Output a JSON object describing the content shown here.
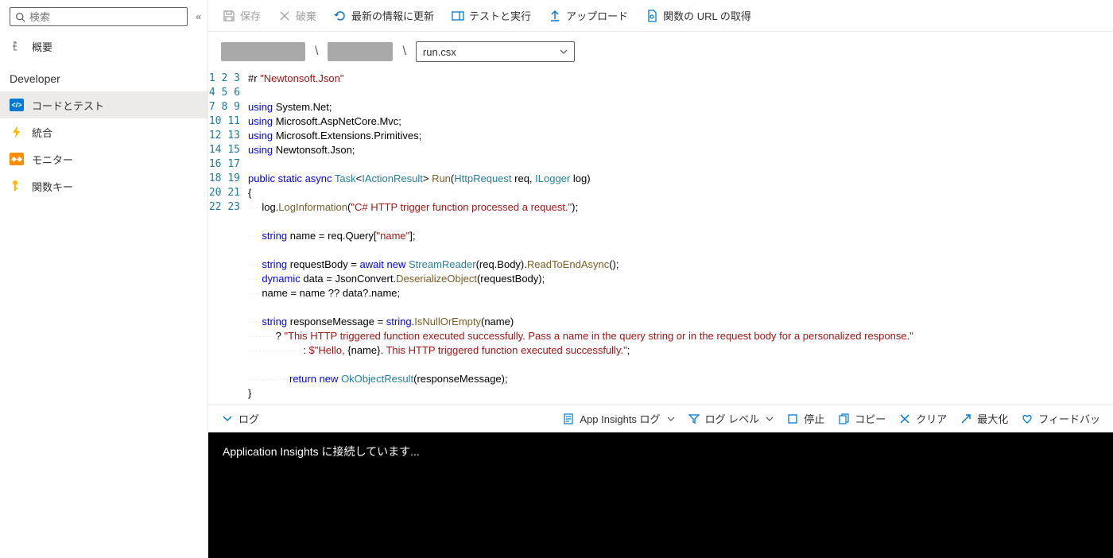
{
  "search": {
    "placeholder": "検索"
  },
  "sidebar": {
    "overview": {
      "label": "概要"
    },
    "sectionDeveloper": "Developer",
    "items": [
      {
        "label": "コードとテスト"
      },
      {
        "label": "統合"
      },
      {
        "label": "モニター"
      },
      {
        "label": "関数キー"
      }
    ]
  },
  "toolbar": {
    "save": "保存",
    "discard": "破棄",
    "refresh": "最新の情報に更新",
    "testRun": "テストと実行",
    "upload": "アップロード",
    "getFunctionUrl": "関数の URL の取得"
  },
  "breadcrumb": {
    "fileSelected": "run.csx"
  },
  "editor": {
    "lineCount": 23,
    "lines": [
      {
        "html": "#r <span class='str'>\"Newtonsoft.Json\"</span>"
      },
      {
        "html": ""
      },
      {
        "html": "<span class='kw'>using</span> System.Net;"
      },
      {
        "html": "<span class='kw'>using</span> Microsoft.AspNetCore.Mvc;"
      },
      {
        "html": "<span class='kw'>using</span> Microsoft.Extensions.Primitives;"
      },
      {
        "html": "<span class='kw'>using</span> Newtonsoft.Json;"
      },
      {
        "html": ""
      },
      {
        "html": "<span class='kw'>public</span> <span class='kw'>static</span> <span class='kw'>async</span> <span class='type'>Task</span>&lt;<span class='type'>IActionResult</span>&gt; <span class='fn'>Run</span>(<span class='type'>HttpRequest</span> req, <span class='type'>ILogger</span> log)"
      },
      {
        "html": "{"
      },
      {
        "html": "<span class='indent-guide'>····</span>log.<span class='mtd'>LogInformation</span>(<span class='str'>\"C# HTTP trigger function processed a request.\"</span>);"
      },
      {
        "html": ""
      },
      {
        "html": "<span class='indent-guide'>····</span><span class='kw'>string</span> name = req.Query[<span class='str'>\"name\"</span>];"
      },
      {
        "html": ""
      },
      {
        "html": "<span class='indent-guide'>····</span><span class='kw'>string</span> requestBody = <span class='kw'>await</span> <span class='kw'>new</span> <span class='type'>StreamReader</span>(req.Body).<span class='mtd'>ReadToEndAsync</span>();"
      },
      {
        "html": "<span class='indent-guide'>····</span><span class='kw'>dynamic</span> data = JsonConvert.<span class='mtd'>DeserializeObject</span>(requestBody);"
      },
      {
        "html": "<span class='indent-guide'>····</span>name = name ?? data?.name;"
      },
      {
        "html": ""
      },
      {
        "html": "<span class='indent-guide'>····</span><span class='kw'>string</span> responseMessage = <span class='kw'>string</span>.<span class='mtd'>IsNullOrEmpty</span>(name)"
      },
      {
        "html": "<span class='indent-guide'>····</span><span class='indent-guide'>····</span>? <span class='str'>\"This HTTP triggered function executed successfully. Pass a name in the query string or in the request body for a personalized response.\"</span>"
      },
      {
        "html": "<span class='indent-guide'>····</span><span class='indent-guide'>····</span><span class='indent-guide'>····</span><span class='indent-guide'>····</span>: <span class='str'>$\"Hello, </span>{name}<span class='str'>. This HTTP triggered function executed successfully.\"</span>;"
      },
      {
        "html": ""
      },
      {
        "html": "<span class='indent-guide'>····</span><span class='indent-guide'>····</span><span class='indent-guide'>····</span><span class='kw'>return</span> <span class='kw'>new</span> <span class='type'>OkObjectResult</span>(responseMessage);"
      },
      {
        "html": "}"
      }
    ]
  },
  "logBar": {
    "log": "ログ",
    "appInsights": "App Insights ログ",
    "logLevel": "ログ レベル",
    "stop": "停止",
    "copy": "コピー",
    "clear": "クリア",
    "maximize": "最大化",
    "feedback": "フィードバッ"
  },
  "console": {
    "text": "Application Insights に接続しています..."
  }
}
